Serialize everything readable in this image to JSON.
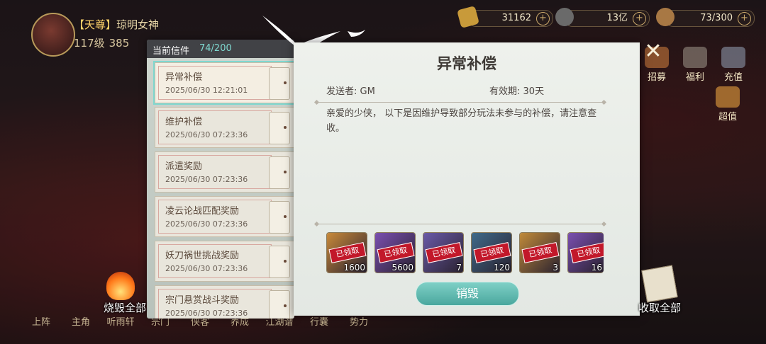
{
  "player": {
    "rank": "【天尊】",
    "name": "琼明女神",
    "level": "117级",
    "power": "385"
  },
  "resources": [
    {
      "value": "31162",
      "icon": "token-icon"
    },
    {
      "value": "13亿",
      "icon": "coin-icon"
    },
    {
      "value": "73/300",
      "icon": "stamina-icon"
    }
  ],
  "side_buttons": {
    "recruit": "招募",
    "welfare": "福利",
    "recharge": "充值",
    "super_value": "超值"
  },
  "bottom_nav": [
    "上阵",
    "主角",
    "听雨轩",
    "宗门",
    "侠客",
    "养成",
    "江湖谱",
    "行囊",
    "势力"
  ],
  "mail_list": {
    "header_label": "当前信件",
    "count": "74/200",
    "items": [
      {
        "title": "异常补偿",
        "date": "2025/06/30 12:21:01"
      },
      {
        "title": "维护补偿",
        "date": "2025/06/30 07:23:36"
      },
      {
        "title": "派遣奖励",
        "date": "2025/06/30 07:23:36"
      },
      {
        "title": "凌云论战匹配奖励",
        "date": "2025/06/30 07:23:36"
      },
      {
        "title": "妖刀祸世挑战奖励",
        "date": "2025/06/30 07:23:36"
      },
      {
        "title": "宗门悬赏战斗奖励",
        "date": "2025/06/30 07:23:36"
      }
    ]
  },
  "mail_detail": {
    "title": "异常补偿",
    "sender_label": "发送者:",
    "sender": "GM",
    "validity_label": "有效期:",
    "validity": "30天",
    "body": "亲爱的少侠， 以下是因维护导致部分玩法未参与的补偿，请注意查收。",
    "claimed_stamp": "已领取",
    "rewards": [
      {
        "qty": "1600",
        "color": "#c8893a"
      },
      {
        "qty": "5600",
        "color": "#7a4fb0"
      },
      {
        "qty": "7",
        "color": "#6a5aa8"
      },
      {
        "qty": "120",
        "color": "#3f6a8a"
      },
      {
        "qty": "3",
        "color": "#c08a3a"
      },
      {
        "qty": "16",
        "color": "#7a4fb0"
      }
    ],
    "destroy_label": "销毁"
  },
  "actions": {
    "burn_all": "烧毁全部",
    "collect_all": "收取全部"
  }
}
